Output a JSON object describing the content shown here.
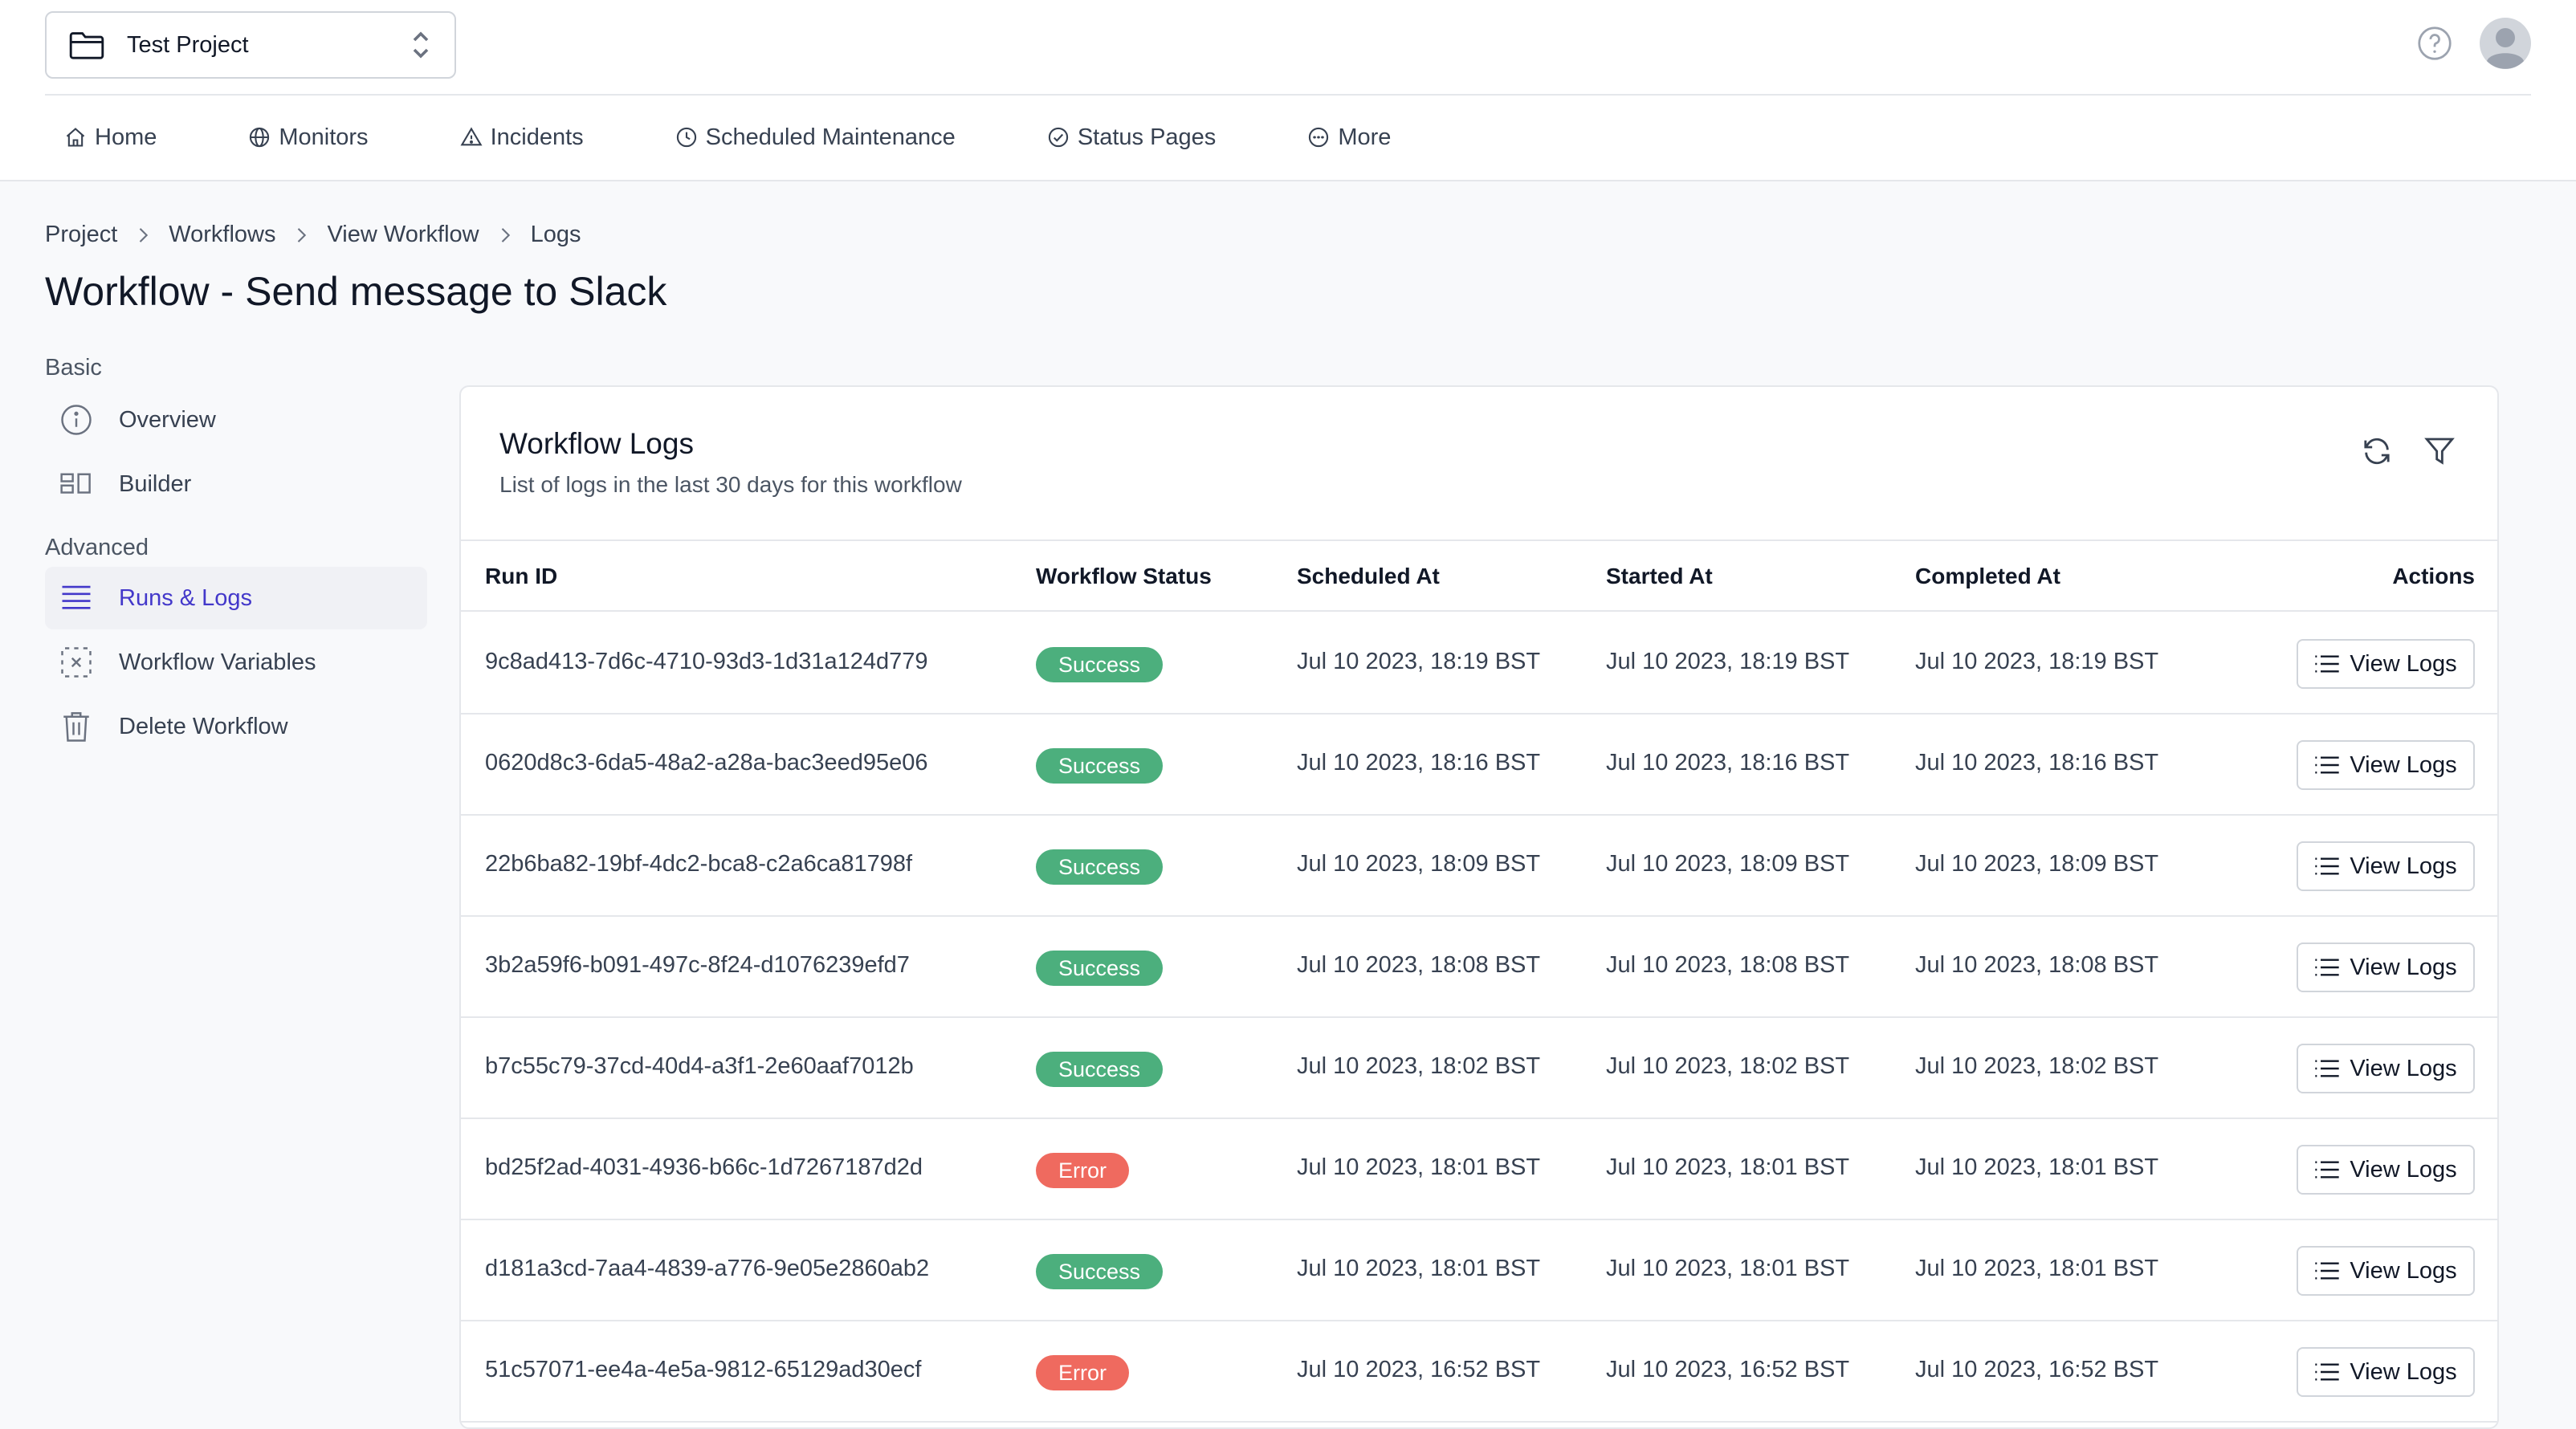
{
  "header": {
    "project_name": "Test Project",
    "icons": [
      "folder-icon",
      "chevron-up-down-icon",
      "help-icon",
      "avatar-icon"
    ]
  },
  "nav": [
    {
      "label": "Home",
      "icon": "home-icon"
    },
    {
      "label": "Monitors",
      "icon": "globe-icon"
    },
    {
      "label": "Incidents",
      "icon": "alert-triangle-icon"
    },
    {
      "label": "Scheduled Maintenance",
      "icon": "clock-icon"
    },
    {
      "label": "Status Pages",
      "icon": "check-circle-icon"
    },
    {
      "label": "More",
      "icon": "more-circle-icon"
    }
  ],
  "breadcrumb": [
    "Project",
    "Workflows",
    "View Workflow",
    "Logs"
  ],
  "page_title": "Workflow - Send message to Slack",
  "sidebar": {
    "basic_label": "Basic",
    "advanced_label": "Advanced",
    "items": [
      {
        "label": "Overview",
        "icon": "info-icon"
      },
      {
        "label": "Builder",
        "icon": "builder-icon"
      },
      {
        "label": "Runs & Logs",
        "icon": "list-icon",
        "active": true
      },
      {
        "label": "Workflow Variables",
        "icon": "variable-icon"
      },
      {
        "label": "Delete Workflow",
        "icon": "trash-icon"
      }
    ]
  },
  "logs_card": {
    "title": "Workflow Logs",
    "subtitle": "List of logs in the last 30 days for this workflow",
    "icons": [
      "refresh-icon",
      "filter-icon"
    ],
    "columns": [
      "Run ID",
      "Workflow Status",
      "Scheduled At",
      "Started At",
      "Completed At",
      "Actions"
    ],
    "action_label": "View Logs",
    "rows": [
      {
        "run_id": "9c8ad413-7d6c-4710-93d3-1d31a124d779",
        "status": "Success",
        "scheduled": "Jul 10 2023, 18:19 BST",
        "started": "Jul 10 2023, 18:19 BST",
        "completed": "Jul 10 2023, 18:19 BST"
      },
      {
        "run_id": "0620d8c3-6da5-48a2-a28a-bac3eed95e06",
        "status": "Success",
        "scheduled": "Jul 10 2023, 18:16 BST",
        "started": "Jul 10 2023, 18:16 BST",
        "completed": "Jul 10 2023, 18:16 BST"
      },
      {
        "run_id": "22b6ba82-19bf-4dc2-bca8-c2a6ca81798f",
        "status": "Success",
        "scheduled": "Jul 10 2023, 18:09 BST",
        "started": "Jul 10 2023, 18:09 BST",
        "completed": "Jul 10 2023, 18:09 BST"
      },
      {
        "run_id": "3b2a59f6-b091-497c-8f24-d1076239efd7",
        "status": "Success",
        "scheduled": "Jul 10 2023, 18:08 BST",
        "started": "Jul 10 2023, 18:08 BST",
        "completed": "Jul 10 2023, 18:08 BST"
      },
      {
        "run_id": "b7c55c79-37cd-40d4-a3f1-2e60aaf7012b",
        "status": "Success",
        "scheduled": "Jul 10 2023, 18:02 BST",
        "started": "Jul 10 2023, 18:02 BST",
        "completed": "Jul 10 2023, 18:02 BST"
      },
      {
        "run_id": "bd25f2ad-4031-4936-b66c-1d7267187d2d",
        "status": "Error",
        "scheduled": "Jul 10 2023, 18:01 BST",
        "started": "Jul 10 2023, 18:01 BST",
        "completed": "Jul 10 2023, 18:01 BST"
      },
      {
        "run_id": "d181a3cd-7aa4-4839-a776-9e05e2860ab2",
        "status": "Success",
        "scheduled": "Jul 10 2023, 18:01 BST",
        "started": "Jul 10 2023, 18:01 BST",
        "completed": "Jul 10 2023, 18:01 BST"
      },
      {
        "run_id": "51c57071-ee4a-4e5a-9812-65129ad30ecf",
        "status": "Error",
        "scheduled": "Jul 10 2023, 16:52 BST",
        "started": "Jul 10 2023, 16:52 BST",
        "completed": "Jul 10 2023, 16:52 BST"
      }
    ]
  },
  "colors": {
    "success": "#4caf7d",
    "error": "#ef6a5f",
    "active_accent": "#4338ca"
  }
}
